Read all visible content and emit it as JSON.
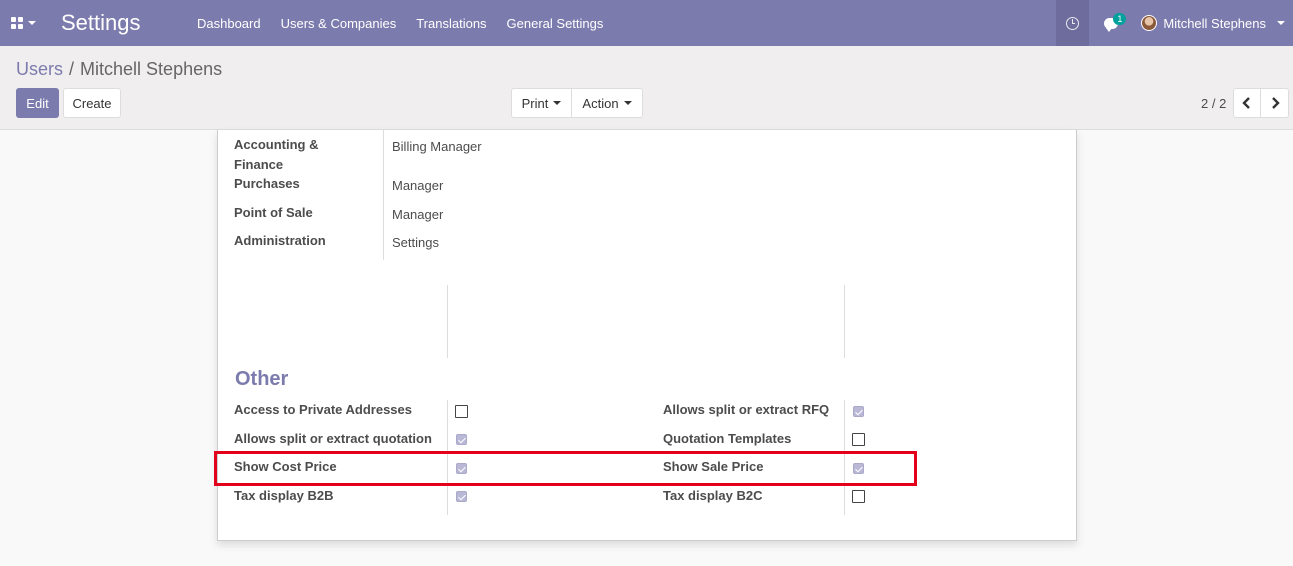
{
  "navbar": {
    "app_title": "Settings",
    "menu": [
      "Dashboard",
      "Users & Companies",
      "Translations",
      "General Settings"
    ],
    "chat_badge": "1",
    "user_name": "Mitchell Stephens",
    "brand_color": "#7c7bad"
  },
  "breadcrumb": {
    "parent": "Users",
    "separator": "/",
    "current": "Mitchell Stephens"
  },
  "buttons": {
    "edit": "Edit",
    "create": "Create",
    "print": "Print",
    "action": "Action"
  },
  "pager": {
    "value": "2 / 2"
  },
  "access_rights": [
    {
      "label": "Accounting & Finance",
      "value": "Billing Manager"
    },
    {
      "label": "Purchases",
      "value": "Manager"
    },
    {
      "label": "Point of Sale",
      "value": "Manager"
    },
    {
      "label": "Administration",
      "value": "Settings"
    }
  ],
  "other": {
    "title": "Other",
    "fields": [
      {
        "label": "Access to Private Addresses",
        "checked": false,
        "readonly": false
      },
      {
        "label": "Allows split or extract RFQ",
        "checked": true,
        "readonly": true
      },
      {
        "label": "Allows split or extract quotation",
        "checked": true,
        "readonly": true
      },
      {
        "label": "Quotation Templates",
        "checked": false,
        "readonly": false
      },
      {
        "label": "Show Cost Price",
        "checked": true,
        "readonly": true
      },
      {
        "label": "Show Sale Price",
        "checked": true,
        "readonly": true
      },
      {
        "label": "Tax display B2B",
        "checked": true,
        "readonly": true
      },
      {
        "label": "Tax display B2C",
        "checked": false,
        "readonly": false
      }
    ]
  },
  "highlight_color": "#e3001b"
}
